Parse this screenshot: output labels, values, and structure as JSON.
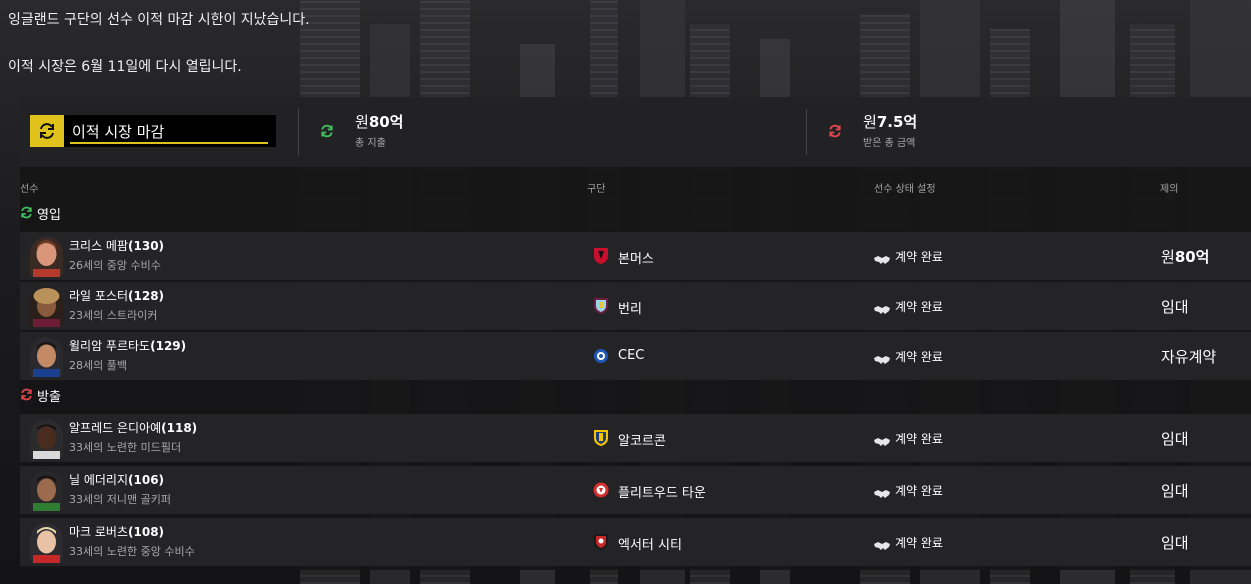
{
  "notice": {
    "line1": "잉글랜드 구단의 선수 이적 마감 시한이 지났습니다.",
    "line2": "이적 시장은 6월 11일에 다시 열립니다."
  },
  "summary": {
    "status_label": "이적 시장 마감",
    "spent": {
      "currency": "원",
      "amount": "80억",
      "label": "총 지출"
    },
    "received": {
      "currency": "원",
      "amount": "7.5억",
      "label": "받은 총 금액"
    }
  },
  "columns": {
    "player": "선수",
    "club": "구단",
    "status": "선수 상태 설정",
    "offer": "제의"
  },
  "sections": {
    "in": {
      "title": "영입",
      "rows": [
        {
          "name": "크리스 메팜",
          "rating": "(130)",
          "desc": "26세의 중앙 수비수",
          "club": "본머스",
          "status": "계약 완료",
          "fee_currency": "원",
          "fee": "80억"
        },
        {
          "name": "라일 포스터",
          "rating": "(128)",
          "desc": "23세의 스트라이커",
          "club": "번리",
          "status": "계약 완료",
          "fee_currency": "",
          "fee": "임대"
        },
        {
          "name": "윌리암 푸르타도",
          "rating": "(129)",
          "desc": "28세의 풀백",
          "club": "CEC",
          "status": "계약 완료",
          "fee_currency": "",
          "fee": "자유계약"
        }
      ]
    },
    "out": {
      "title": "방출",
      "rows": [
        {
          "name": "알프레드 은디아예",
          "rating": "(118)",
          "desc": "33세의 노련한 미드필더",
          "club": "알코르콘",
          "status": "계약 완료",
          "fee_currency": "",
          "fee": "임대"
        },
        {
          "name": "닐 에더리지",
          "rating": "(106)",
          "desc": "33세의 저니맨 골키퍼",
          "club": "플리트우드 타운",
          "status": "계약 완료",
          "fee_currency": "",
          "fee": "임대"
        },
        {
          "name": "마크 로버츠",
          "rating": "(108)",
          "desc": "33세의 노련한 중앙 수비수",
          "club": "엑서터 시티",
          "status": "계약 완료",
          "fee_currency": "",
          "fee": "임대"
        }
      ]
    }
  },
  "colors": {
    "accent": "#e0c21c",
    "in": "#3fbf5f",
    "out": "#e0474c"
  },
  "icons": {
    "status": "transfer-arrows-icon",
    "in": "transfer-arrows-green-icon",
    "out": "transfer-arrows-red-icon",
    "handshake": "handshake-icon"
  }
}
